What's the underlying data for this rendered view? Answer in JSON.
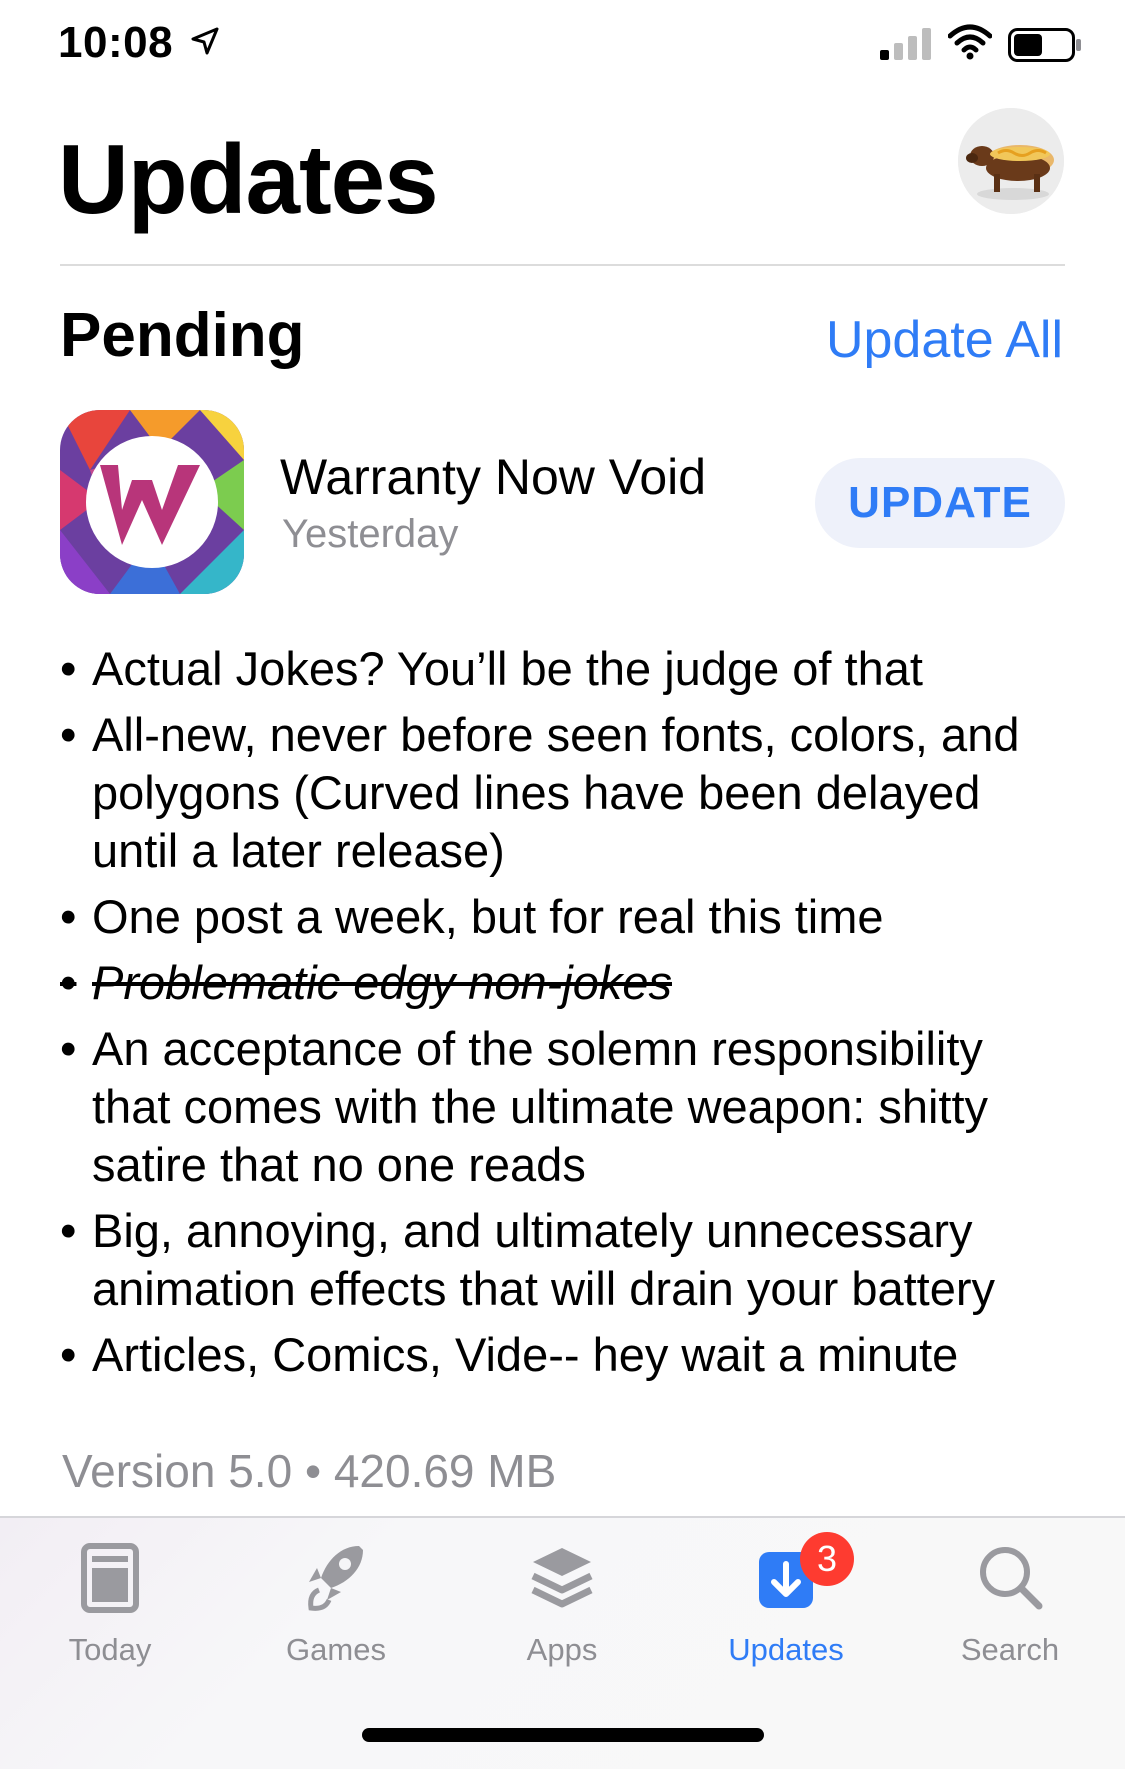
{
  "status_bar": {
    "time": "10:08",
    "icons": [
      "location-arrow-icon",
      "cellular-signal-icon",
      "wifi-icon",
      "battery-icon"
    ]
  },
  "header": {
    "title": "Updates",
    "avatar": "profile-avatar-dachshund-hotdog"
  },
  "pending": {
    "title": "Pending",
    "update_all_label": "Update All",
    "app": {
      "name": "Warranty Now Void",
      "date": "Yesterday",
      "button_label": "UPDATE",
      "icon": "warranty-now-void-app-icon"
    },
    "notes": [
      {
        "text": "Actual Jokes? You’ll be the judge of that",
        "strikethrough": false
      },
      {
        "text": "All-new, never before seen fonts, colors, and polygons (Curved lines have been delayed until a later release)",
        "strikethrough": false
      },
      {
        "text": "One post a week, but for real this time",
        "strikethrough": false
      },
      {
        "text": "Problematic edgy non-jokes",
        "strikethrough": true
      },
      {
        "text": "An acceptance of the solemn responsibility that comes with the ultimate weapon: shitty satire that no one reads",
        "strikethrough": false
      },
      {
        "text": "Big, annoying, and ultimately unnecessary animation effects that will drain your battery",
        "strikethrough": false
      },
      {
        "text": "Articles, Comics, Vide-- hey wait a minute",
        "strikethrough": false
      }
    ],
    "version_line": "Version 5.0 • 420.69 MB"
  },
  "tab_bar": {
    "tabs": [
      {
        "label": "Today",
        "icon": "today-icon",
        "active": false
      },
      {
        "label": "Games",
        "icon": "rocket-icon",
        "active": false
      },
      {
        "label": "Apps",
        "icon": "layers-icon",
        "active": false
      },
      {
        "label": "Updates",
        "icon": "download-arrow-icon",
        "active": true,
        "badge": "3"
      },
      {
        "label": "Search",
        "icon": "search-icon",
        "active": false
      }
    ]
  },
  "colors": {
    "accent": "#2f7cf6",
    "secondary_text": "#8e8e93",
    "badge": "#fe3b30",
    "button_bg": "#eef1fa"
  }
}
